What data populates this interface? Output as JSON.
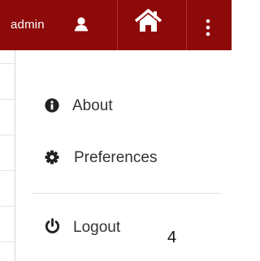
{
  "header": {
    "username": "admin",
    "user_icon": "user-icon",
    "home_icon": "home-icon",
    "menu_icon": "vertical-ellipsis-icon",
    "bar_color": "#8e0a0a"
  },
  "menu": {
    "items": [
      {
        "label": "About",
        "icon": "info-circle-icon"
      },
      {
        "label": "Preferences",
        "icon": "gear-icon"
      },
      {
        "label": "Logout",
        "icon": "power-icon"
      }
    ]
  },
  "annotation": "4"
}
